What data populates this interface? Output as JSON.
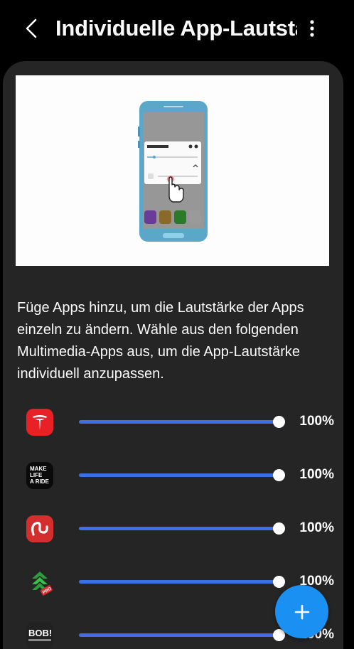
{
  "header": {
    "title": "Individuelle App-Lautstärke",
    "back_icon": "back-arrow-icon",
    "more_icon": "more-vertical-icon"
  },
  "description": "Füge Apps hinzu, um die Lautstärke der Apps einzeln zu ändern. Wähle aus den folgenden Multimedia-Apps aus, um die App-Lautstärke individuell anzupassen.",
  "apps": [
    {
      "icon": "tesla-icon",
      "volume_pct": 100,
      "label": "100%"
    },
    {
      "icon": "make-life-a-ride-icon",
      "icon_text": [
        "MAKE",
        "LIFE",
        "A RIDE"
      ],
      "volume_pct": 100,
      "label": "100%"
    },
    {
      "icon": "red-squiggle-app-icon",
      "volume_pct": 100,
      "label": "100%"
    },
    {
      "icon": "green-arrows-pro-app-icon",
      "icon_badge": "PRO",
      "volume_pct": 100,
      "label": "100%"
    },
    {
      "icon": "bob-app-icon",
      "icon_text": [
        "BOB!"
      ],
      "volume_pct": 100,
      "label": "100%"
    }
  ],
  "fab": {
    "icon": "plus-icon"
  },
  "colors": {
    "background": "#000000",
    "card": "#252525",
    "slider_active": "#3f6fe6",
    "fab": "#1a90f2",
    "tesla_red": "#e82127"
  }
}
